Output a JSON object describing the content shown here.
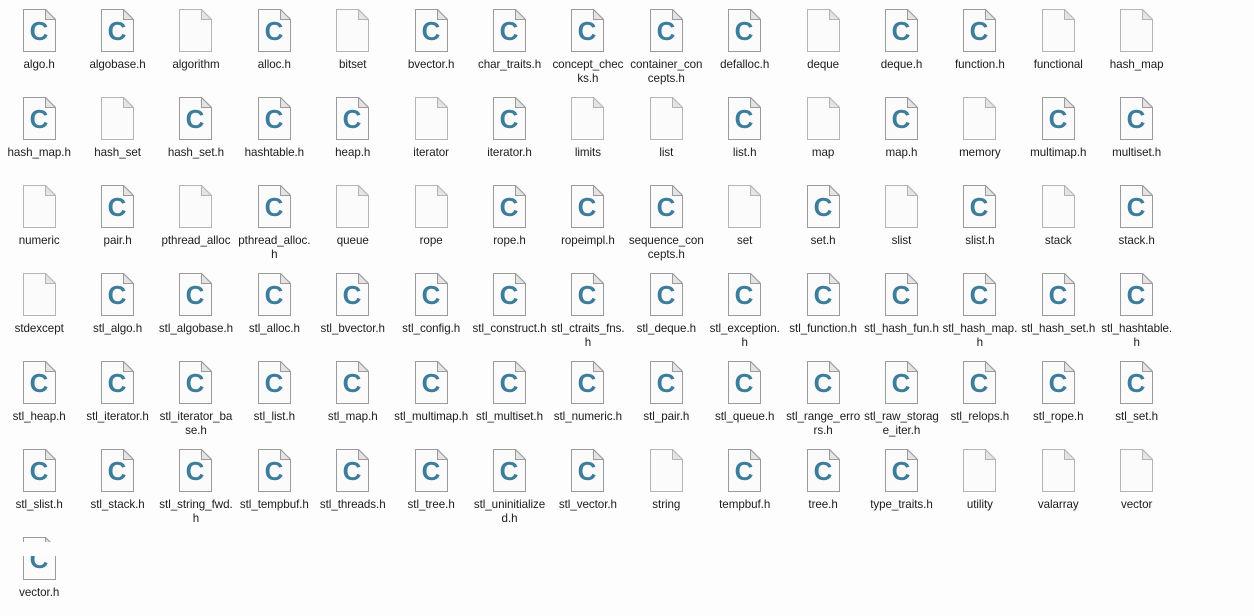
{
  "window": {
    "title": "File explorer content pane",
    "background_color": "#fdfdfd",
    "view_mode": "medium-icons",
    "columns": 16,
    "rows": 6
  },
  "icon_styles": {
    "c_header_icon": {
      "name": "c-source-file-icon",
      "glyph": "C",
      "glyph_color": "#3d7d9c",
      "page_fill": "#fbfbfb",
      "page_border": "#9a9a9a",
      "fold_fill": "#e4e4e4"
    },
    "blank_icon": {
      "name": "blank-file-icon",
      "glyph": "",
      "glyph_color": "#3d7d9c",
      "page_fill": "#fbfbfb",
      "page_border": "#b4b4b4",
      "fold_fill": "#e4e4e4"
    }
  },
  "files": [
    {
      "name": "algo.h",
      "icon": "c"
    },
    {
      "name": "algobase.h",
      "icon": "c"
    },
    {
      "name": "algorithm",
      "icon": "blank"
    },
    {
      "name": "alloc.h",
      "icon": "c"
    },
    {
      "name": "bitset",
      "icon": "blank"
    },
    {
      "name": "bvector.h",
      "icon": "c"
    },
    {
      "name": "char_traits.h",
      "icon": "c"
    },
    {
      "name": "concept_checks.h",
      "icon": "c"
    },
    {
      "name": "container_concepts.h",
      "icon": "c"
    },
    {
      "name": "defalloc.h",
      "icon": "c"
    },
    {
      "name": "deque",
      "icon": "blank"
    },
    {
      "name": "deque.h",
      "icon": "c"
    },
    {
      "name": "function.h",
      "icon": "c"
    },
    {
      "name": "functional",
      "icon": "blank"
    },
    {
      "name": "hash_map",
      "icon": "blank"
    },
    {
      "name": "hash_map.h",
      "icon": "c"
    },
    {
      "name": "hash_set",
      "icon": "blank"
    },
    {
      "name": "hash_set.h",
      "icon": "c"
    },
    {
      "name": "hashtable.h",
      "icon": "c"
    },
    {
      "name": "heap.h",
      "icon": "c"
    },
    {
      "name": "iterator",
      "icon": "blank"
    },
    {
      "name": "iterator.h",
      "icon": "c"
    },
    {
      "name": "limits",
      "icon": "blank"
    },
    {
      "name": "list",
      "icon": "blank"
    },
    {
      "name": "list.h",
      "icon": "c"
    },
    {
      "name": "map",
      "icon": "blank"
    },
    {
      "name": "map.h",
      "icon": "c"
    },
    {
      "name": "memory",
      "icon": "blank"
    },
    {
      "name": "multimap.h",
      "icon": "c"
    },
    {
      "name": "multiset.h",
      "icon": "c"
    },
    {
      "name": "numeric",
      "icon": "blank"
    },
    {
      "name": "pair.h",
      "icon": "c"
    },
    {
      "name": "pthread_alloc",
      "icon": "blank"
    },
    {
      "name": "pthread_alloc.h",
      "icon": "c"
    },
    {
      "name": "queue",
      "icon": "blank"
    },
    {
      "name": "rope",
      "icon": "blank"
    },
    {
      "name": "rope.h",
      "icon": "c"
    },
    {
      "name": "ropeimpl.h",
      "icon": "c"
    },
    {
      "name": "sequence_concepts.h",
      "icon": "c"
    },
    {
      "name": "set",
      "icon": "blank"
    },
    {
      "name": "set.h",
      "icon": "c"
    },
    {
      "name": "slist",
      "icon": "blank"
    },
    {
      "name": "slist.h",
      "icon": "c"
    },
    {
      "name": "stack",
      "icon": "blank"
    },
    {
      "name": "stack.h",
      "icon": "c"
    },
    {
      "name": "stdexcept",
      "icon": "blank"
    },
    {
      "name": "stl_algo.h",
      "icon": "c"
    },
    {
      "name": "stl_algobase.h",
      "icon": "c"
    },
    {
      "name": "stl_alloc.h",
      "icon": "c"
    },
    {
      "name": "stl_bvector.h",
      "icon": "c"
    },
    {
      "name": "stl_config.h",
      "icon": "c"
    },
    {
      "name": "stl_construct.h",
      "icon": "c"
    },
    {
      "name": "stl_ctraits_fns.h",
      "icon": "c"
    },
    {
      "name": "stl_deque.h",
      "icon": "c"
    },
    {
      "name": "stl_exception.h",
      "icon": "c"
    },
    {
      "name": "stl_function.h",
      "icon": "c"
    },
    {
      "name": "stl_hash_fun.h",
      "icon": "c"
    },
    {
      "name": "stl_hash_map.h",
      "icon": "c"
    },
    {
      "name": "stl_hash_set.h",
      "icon": "c"
    },
    {
      "name": "stl_hashtable.h",
      "icon": "c"
    },
    {
      "name": "stl_heap.h",
      "icon": "c"
    },
    {
      "name": "stl_iterator.h",
      "icon": "c"
    },
    {
      "name": "stl_iterator_base.h",
      "icon": "c"
    },
    {
      "name": "stl_list.h",
      "icon": "c"
    },
    {
      "name": "stl_map.h",
      "icon": "c"
    },
    {
      "name": "stl_multimap.h",
      "icon": "c"
    },
    {
      "name": "stl_multiset.h",
      "icon": "c"
    },
    {
      "name": "stl_numeric.h",
      "icon": "c"
    },
    {
      "name": "stl_pair.h",
      "icon": "c"
    },
    {
      "name": "stl_queue.h",
      "icon": "c"
    },
    {
      "name": "stl_range_errors.h",
      "icon": "c"
    },
    {
      "name": "stl_raw_storage_iter.h",
      "icon": "c"
    },
    {
      "name": "stl_relops.h",
      "icon": "c"
    },
    {
      "name": "stl_rope.h",
      "icon": "c"
    },
    {
      "name": "stl_set.h",
      "icon": "c"
    },
    {
      "name": "stl_slist.h",
      "icon": "c"
    },
    {
      "name": "stl_stack.h",
      "icon": "c"
    },
    {
      "name": "stl_string_fwd.h",
      "icon": "c"
    },
    {
      "name": "stl_tempbuf.h",
      "icon": "c"
    },
    {
      "name": "stl_threads.h",
      "icon": "c"
    },
    {
      "name": "stl_tree.h",
      "icon": "c"
    },
    {
      "name": "stl_uninitialized.h",
      "icon": "c"
    },
    {
      "name": "stl_vector.h",
      "icon": "c"
    },
    {
      "name": "string",
      "icon": "blank"
    },
    {
      "name": "tempbuf.h",
      "icon": "c"
    },
    {
      "name": "tree.h",
      "icon": "c"
    },
    {
      "name": "type_traits.h",
      "icon": "c"
    },
    {
      "name": "utility",
      "icon": "blank"
    },
    {
      "name": "valarray",
      "icon": "blank"
    },
    {
      "name": "vector",
      "icon": "blank"
    },
    {
      "name": "vector.h",
      "icon": "c"
    }
  ]
}
